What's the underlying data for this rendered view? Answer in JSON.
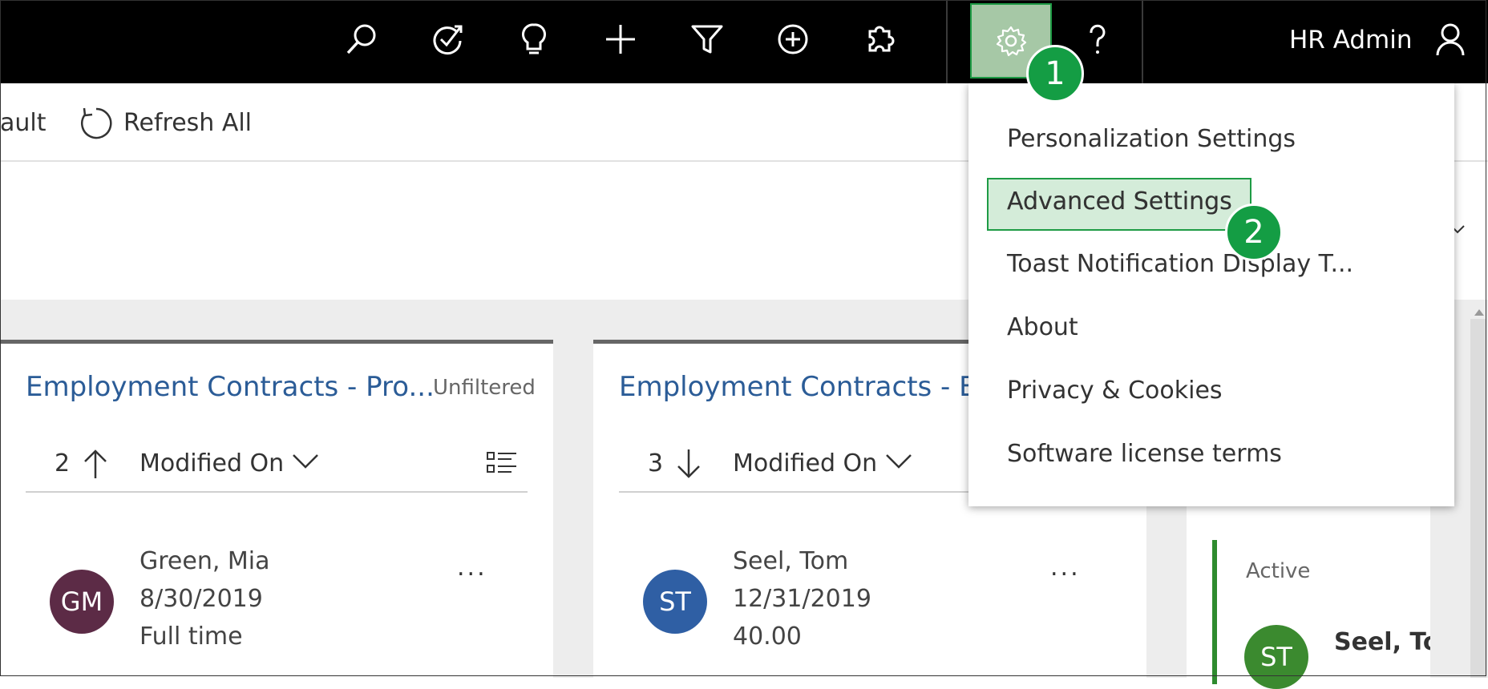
{
  "header": {
    "icons": [
      "search-icon",
      "task-icon",
      "lightbulb-icon",
      "plus-icon",
      "filter-icon",
      "add-circle-icon",
      "puzzle-icon",
      "gear-icon",
      "help-icon",
      "user-icon"
    ],
    "user_name": "HR Admin"
  },
  "command_bar": {
    "partial_label": "ault",
    "refresh_label": "Refresh All"
  },
  "settings_menu": {
    "items": [
      "Personalization Settings",
      "Advanced Settings",
      "Toast Notification Display T...",
      "About",
      "Privacy & Cookies",
      "Software license terms"
    ],
    "highlighted_item": "Advanced Settings"
  },
  "callouts": {
    "step1": "1",
    "step2": "2"
  },
  "cards": [
    {
      "title": "Employment Contracts - Pro...",
      "filter_label": "Unfiltered",
      "sort_count": "2",
      "sort_field": "Modified On",
      "record": {
        "initials": "GM",
        "name": "Green, Mia",
        "date": "8/30/2019",
        "detail": "Full time",
        "avatar_color": "#5c2b46"
      },
      "more": "..."
    },
    {
      "title": "Employment Contracts - En",
      "sort_count": "3",
      "sort_field": "Modified On",
      "record": {
        "initials": "ST",
        "name": "Seel, Tom",
        "date": "12/31/2019",
        "detail": "40.00",
        "avatar_color": "#2f5fa4"
      },
      "more": "..."
    },
    {
      "status": "Active",
      "record": {
        "initials": "ST",
        "name": "Seel, Tor",
        "avatar_color": "#3b8a2f"
      }
    }
  ],
  "colors": {
    "accent_green": "#149d44",
    "link_blue": "#2b5c97",
    "topbar": "#000000"
  }
}
